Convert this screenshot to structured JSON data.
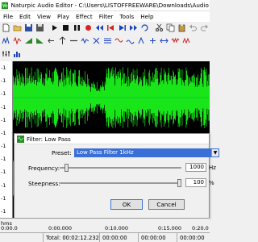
{
  "window": {
    "title": "Naturpic Audio Editor - C:\\Users\\LISTOFFREEWARE\\Downloads\\Audio Filter Softwa"
  },
  "menu": [
    "File",
    "Edit",
    "View",
    "Play",
    "Effect",
    "Filter",
    "Tools",
    "Help"
  ],
  "ruler": {
    "ticks": [
      "-1",
      "-1",
      "-1",
      "-1",
      "-1",
      "-1",
      "-1",
      "-1",
      "-1",
      "-1",
      "-1",
      "-1"
    ]
  },
  "dialog": {
    "title": "Filter: Low Pass",
    "preset_label": "Preset:",
    "preset_value": "Low Pass Filter 1kHz",
    "frequency_label": "Frequency:",
    "frequency_value": "1000",
    "frequency_unit": "Hz",
    "frequency_level": 0.04,
    "steepness_label": "Steepness:",
    "steepness_value": "100",
    "steepness_unit": "%",
    "steepness_level": 1.0,
    "ok_label": "OK",
    "cancel_label": "Cancel"
  },
  "timeline": {
    "unit_label": "hms",
    "start": "0:00.0",
    "marks": [
      "0:00.000",
      "0:10.000",
      "0:15.000",
      "0:20.0"
    ]
  },
  "status": {
    "total": "Total: 00:02:12.232",
    "pos1": "00:00:00",
    "pos2": "00:00:00",
    "pos3": "00:00:00"
  },
  "colors": {
    "waveform": "#19e619",
    "wave_bg": "#000000",
    "accent": "#3a6fd8"
  }
}
